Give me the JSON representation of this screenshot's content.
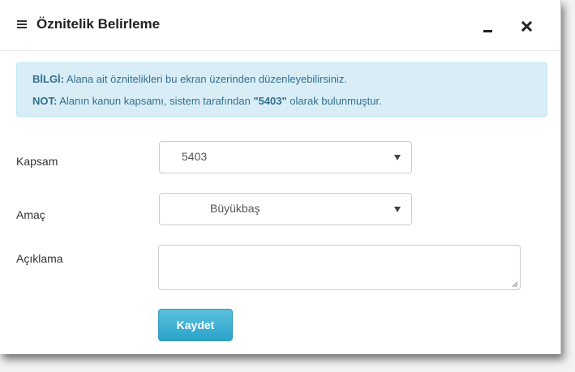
{
  "dialog": {
    "title": "Öznitelik Belirleme"
  },
  "info": {
    "line1_prefix": "BİLGİ:",
    "line1_text": " Alana ait öznitelikleri bu ekran üzerinden düzenleyebilirsiniz.",
    "line2_prefix": "NOT:",
    "line2_text": " Alanın kanun kapsamı, sistem tarafından ",
    "line2_code": "\"5403\"",
    "line2_suffix": " olarak bulunmuştur."
  },
  "form": {
    "scope": {
      "label": "Kapsam",
      "value": "5403"
    },
    "purpose": {
      "label": "Amaç",
      "value": "Büyükbaş"
    },
    "description": {
      "label": "Açıklama",
      "value": ""
    },
    "save_label": "Kaydet"
  },
  "colors": {
    "info_bg": "#d9edf7",
    "info_text": "#31708f",
    "button": "#5bc0de"
  }
}
